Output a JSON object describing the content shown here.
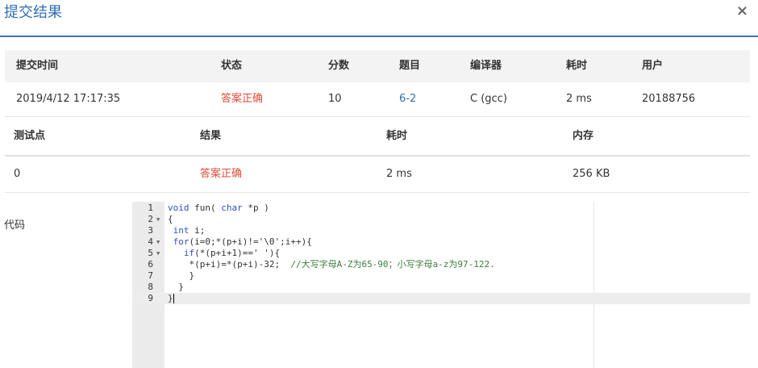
{
  "modal": {
    "title": "提交结果",
    "close": "×"
  },
  "submission": {
    "headers": [
      "提交时间",
      "状态",
      "分数",
      "题目",
      "编译器",
      "耗时",
      "用户"
    ],
    "row": {
      "time": "2019/4/12 17:17:35",
      "status": "答案正确",
      "score": "10",
      "problem": "6-2",
      "compiler": "C (gcc)",
      "elapsed": "2 ms",
      "user": "20188756"
    }
  },
  "testcases": {
    "headers": [
      "测试点",
      "结果",
      "耗时",
      "内存"
    ],
    "rows": [
      {
        "point": "0",
        "result": "答案正确",
        "time": "2 ms",
        "memory": "256 KB"
      }
    ]
  },
  "code": {
    "label": "代码",
    "lines": [
      {
        "n": "1",
        "fold": false,
        "segments": [
          {
            "t": "void",
            "k": "kw"
          },
          {
            "t": " fun( ",
            "k": ""
          },
          {
            "t": "char",
            "k": "kw"
          },
          {
            "t": " *p )",
            "k": ""
          }
        ]
      },
      {
        "n": "2",
        "fold": true,
        "segments": [
          {
            "t": "{",
            "k": ""
          }
        ]
      },
      {
        "n": "3",
        "fold": false,
        "segments": [
          {
            "t": " ",
            "k": ""
          },
          {
            "t": "int",
            "k": "kw"
          },
          {
            "t": " i;",
            "k": ""
          }
        ]
      },
      {
        "n": "4",
        "fold": true,
        "segments": [
          {
            "t": " ",
            "k": ""
          },
          {
            "t": "for",
            "k": "kw"
          },
          {
            "t": "(i=0;*(p+i)!='\\0';i++){",
            "k": ""
          }
        ]
      },
      {
        "n": "5",
        "fold": true,
        "segments": [
          {
            "t": "   ",
            "k": ""
          },
          {
            "t": "if",
            "k": "kw"
          },
          {
            "t": "(*(p+i+1)==' '){",
            "k": ""
          }
        ]
      },
      {
        "n": "6",
        "fold": false,
        "segments": [
          {
            "t": "    *(p+i)=*(p+i)-32;  ",
            "k": ""
          },
          {
            "t": "//大写字母A-Z为65-90；小写字母a-z为97-122.",
            "k": "cm"
          }
        ]
      },
      {
        "n": "7",
        "fold": false,
        "segments": [
          {
            "t": "    }",
            "k": ""
          }
        ]
      },
      {
        "n": "8",
        "fold": false,
        "segments": [
          {
            "t": "  }",
            "k": ""
          }
        ]
      },
      {
        "n": "9",
        "fold": false,
        "segments": [
          {
            "t": "}",
            "k": ""
          }
        ]
      }
    ],
    "active_line": "9"
  }
}
